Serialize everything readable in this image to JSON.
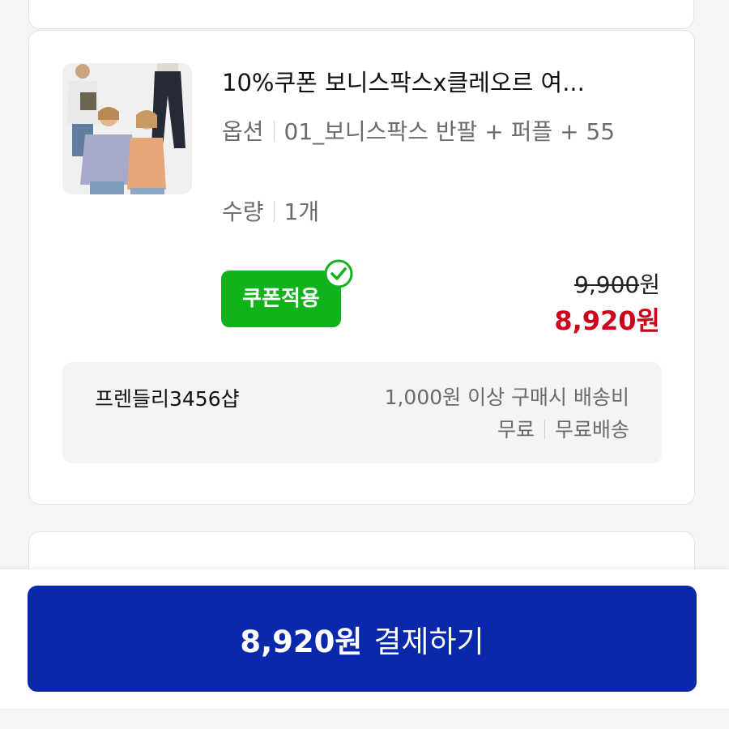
{
  "product": {
    "title": "10%쿠폰 보니스팍스x클레오르 여...",
    "option_label": "옵션",
    "option_value": "01_보니스팍스 반팔 + 퍼플 + 55",
    "quantity_label": "수량",
    "quantity_value": "1개",
    "coupon_badge": "쿠폰적용",
    "original_price": "9,900",
    "original_unit": "원",
    "sale_price": "8,920원"
  },
  "seller": {
    "name": "프렌들리3456샵",
    "shipping_condition": "1,000원 이상 구매시 배송비",
    "shipping_free": "무료",
    "shipping_type": "무료배송"
  },
  "checkout": {
    "amount": "8,920원",
    "label": "결제하기"
  },
  "colors": {
    "coupon_green": "#12b21d",
    "sale_red": "#d0021b",
    "checkout_blue": "#0928ab"
  },
  "icons": [
    "product-thumbnail",
    "check-circle-icon"
  ]
}
